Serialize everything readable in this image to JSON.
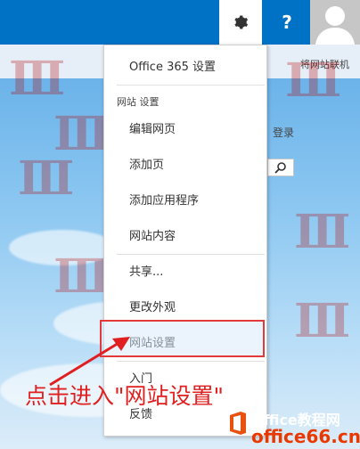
{
  "suitebar": {
    "help_label": "?",
    "gear_icon": "gear-icon",
    "avatar_icon": "user-avatar-icon",
    "accent": "#0072c6"
  },
  "ribbon": {
    "follow_label": "将网站联机"
  },
  "right": {
    "login_label": "登录",
    "search_icon": "search-icon"
  },
  "menu": {
    "office365_settings": "Office 365 设置",
    "site_settings_section": "网站 设置",
    "items": [
      "编辑网页",
      "添加页",
      "添加应用程序",
      "网站内容",
      "共享...",
      "更改外观",
      "网站设置",
      "入门",
      "反馈"
    ]
  },
  "annotation": {
    "text": "点击进入\"网站设置\"",
    "color": "#e02020"
  },
  "logo": {
    "line1": "Office教程网",
    "line2": "office66.cn"
  }
}
